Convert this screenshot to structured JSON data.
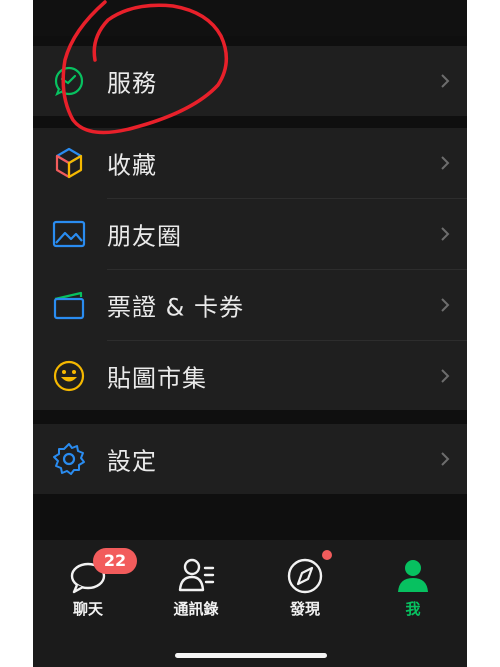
{
  "menu": {
    "services": "服務",
    "favorites": "收藏",
    "moments": "朋友圈",
    "cards": "票證 & 卡券",
    "stickers": "貼圖市集",
    "settings": "設定"
  },
  "tabbar": {
    "chats": {
      "label": "聊天",
      "badge": "22"
    },
    "contacts": {
      "label": "通訊錄"
    },
    "discover": {
      "label": "發現"
    },
    "me": {
      "label": "我"
    }
  },
  "colors": {
    "accent": "#07c160",
    "badge": "#f25c5c",
    "annotation": "#e8202a",
    "favorites_icon": "multicolor-cube",
    "moments_icon": "#2a8cf0",
    "cards_icon": "#2a8cf0",
    "stickers_icon": "#f5b800",
    "settings_icon": "#2a8cf0"
  },
  "icons": {
    "services": "services-icon",
    "favorites": "cube-icon",
    "moments": "image-icon",
    "cards": "wallet-card-icon",
    "stickers": "smiley-icon",
    "settings": "gear-icon",
    "chats": "chat-bubble-icon",
    "contacts": "contacts-icon",
    "discover": "compass-icon",
    "me": "person-icon"
  }
}
